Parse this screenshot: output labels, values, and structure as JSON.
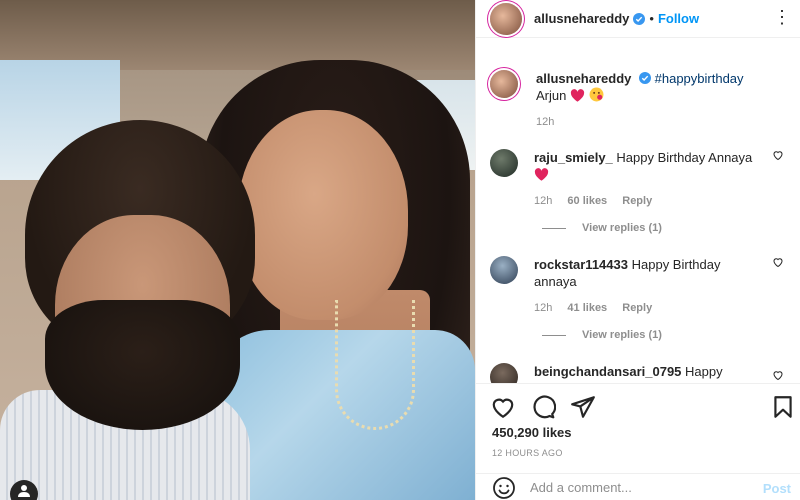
{
  "post": {
    "username": "allusnehareddy",
    "follow_label": "Follow",
    "dot": "•",
    "more_label": "⋮"
  },
  "caption": {
    "username": "allusnehareddy",
    "hashtag": "#happybirthday",
    "text": "Arjun",
    "time": "12h"
  },
  "comments": [
    {
      "username": "raju_smiely_",
      "text": "Happy Birthday Annaya",
      "time": "12h",
      "likes": "60 likes",
      "reply_label": "Reply",
      "view_replies": "View replies (1)"
    },
    {
      "username": "rockstar114433",
      "text": "Happy Birthday annaya",
      "time": "12h",
      "likes": "41 likes",
      "reply_label": "Reply",
      "view_replies": "View replies (1)"
    },
    {
      "username": "beingchandansari_0795",
      "text": "Happy"
    }
  ],
  "actions": {
    "likes_count": "450,290 likes",
    "time_ago": "12 HOURS AGO",
    "comment_placeholder": "Add a comment...",
    "post_label": "Post"
  },
  "colors": {
    "accent": "#0095f6",
    "heart": "#ed4956",
    "muted": "#8e8e8e",
    "post_disabled": "#b2dffc"
  },
  "icons": [
    "user-tag-icon",
    "verified-badge-icon",
    "more-options-icon",
    "heart-icon",
    "comment-icon",
    "share-icon",
    "bookmark-icon",
    "emoji-icon"
  ]
}
